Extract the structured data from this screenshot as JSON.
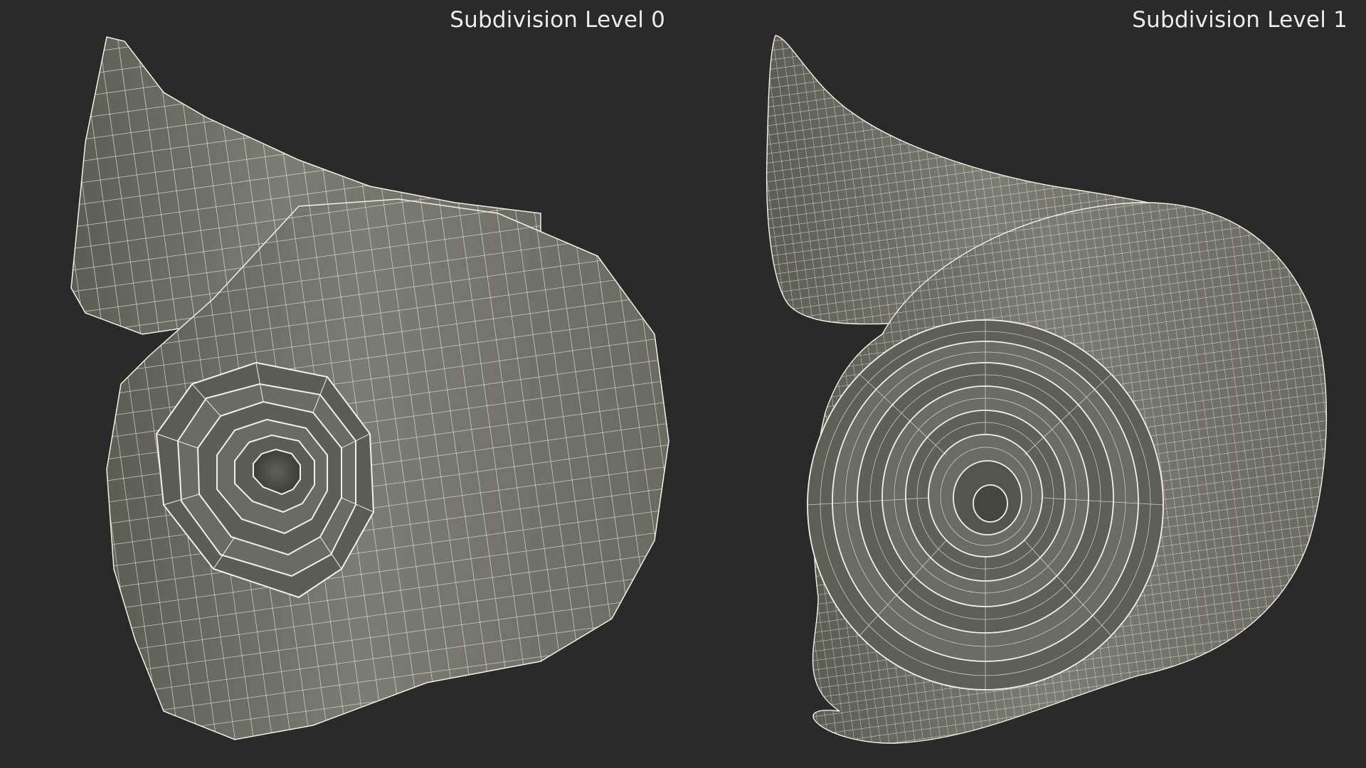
{
  "panels": [
    {
      "label": "Subdivision Level 0"
    },
    {
      "label": "Subdivision Level 1"
    }
  ],
  "colors": {
    "background": "#2a2a2a",
    "mesh_fill": "#74756c",
    "mesh_shadow": "#3f403b",
    "wire": "#f2f0e4",
    "label": "#ececec"
  }
}
